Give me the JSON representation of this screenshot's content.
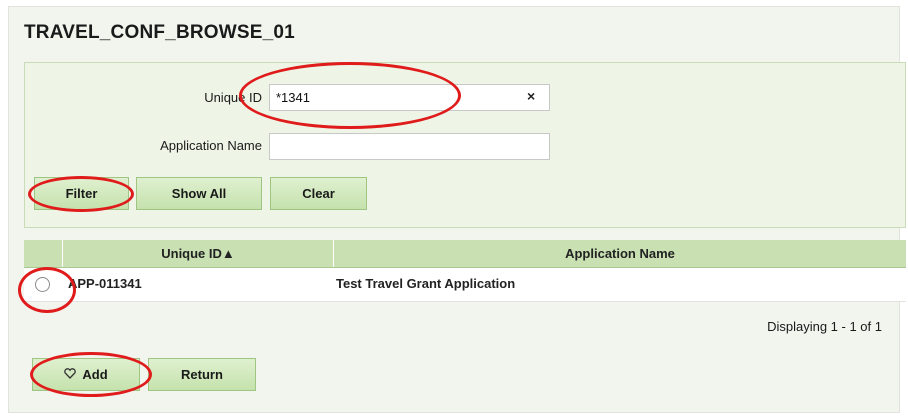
{
  "title": "TRAVEL_CONF_BROWSE_01",
  "filters": {
    "unique_id_label": "Unique ID",
    "unique_id_value": "*1341",
    "clear_glyph": "×",
    "application_name_label": "Application Name",
    "application_name_value": ""
  },
  "buttons": {
    "filter": "Filter",
    "show_all": "Show All",
    "clear": "Clear",
    "add": "Add",
    "return": "Return"
  },
  "grid": {
    "columns": [
      "Unique ID▲",
      "Application Name"
    ],
    "rows": [
      {
        "unique_id": "APP-011341",
        "application_name": "Test Travel Grant Application"
      }
    ]
  },
  "pager": {
    "text": "Displaying 1 - 1 of 1"
  },
  "icons": {
    "add_icon": "check-heart-icon"
  },
  "colors": {
    "annotation": "#e01b1b",
    "header": "#c8e0b2",
    "button": "#c5e2ad"
  }
}
